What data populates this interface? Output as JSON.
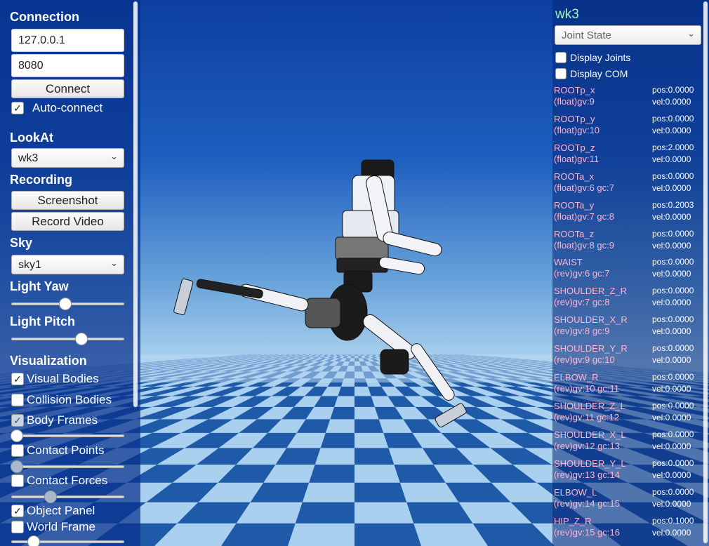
{
  "connection": {
    "title": "Connection",
    "ip": "127.0.0.1",
    "port": "8080",
    "connect_label": "Connect",
    "auto_connect_label": "Auto-connect",
    "auto_connect_checked": true
  },
  "lookat": {
    "title": "LookAt",
    "selected": "wk3"
  },
  "recording": {
    "title": "Recording",
    "screenshot_label": "Screenshot",
    "record_label": "Record Video"
  },
  "sky": {
    "title": "Sky",
    "selected": "sky1"
  },
  "light": {
    "yaw_title": "Light Yaw",
    "yaw_value": 0.48,
    "pitch_title": "Light Pitch",
    "pitch_value": 0.62
  },
  "visualization": {
    "title": "Visualization",
    "visual_bodies": {
      "label": "Visual Bodies",
      "checked": true
    },
    "collision_bodies": {
      "label": "Collision Bodies",
      "checked": false
    },
    "body_frames": {
      "label": "Body Frames",
      "checked": true,
      "slider": 0.05
    },
    "contact_points": {
      "label": "Contact Points",
      "checked": false,
      "slider": 0.05
    },
    "contact_forces": {
      "label": "Contact Forces",
      "checked": false,
      "slider": 0.35
    },
    "object_panel": {
      "label": "Object Panel",
      "checked": true
    },
    "world_frame": {
      "label": "World Frame",
      "checked": false,
      "slider": 0.2
    }
  },
  "object_panel": {
    "name": "wk3",
    "view_selected": "Joint State",
    "display_joints_label": "Display Joints",
    "display_com_label": "Display COM",
    "joints": [
      {
        "name": "ROOTp_x",
        "type": "(float)gv:9",
        "pos": "pos:0.0000",
        "vel": "vel:0.0000"
      },
      {
        "name": "ROOTp_y",
        "type": "(float)gv:10",
        "pos": "pos:0.0000",
        "vel": "vel:0.0000"
      },
      {
        "name": "ROOTp_z",
        "type": "(float)gv:11",
        "pos": "pos:2.0000",
        "vel": "vel:0.0000"
      },
      {
        "name": "ROOTa_x",
        "type": "(float)gv:6 gc:7",
        "pos": "pos:0.0000",
        "vel": "vel:0.0000"
      },
      {
        "name": "ROOTa_y",
        "type": "(float)gv:7 gc:8",
        "pos": "pos:0.2003",
        "vel": "vel:0.0000"
      },
      {
        "name": "ROOTa_z",
        "type": "(float)gv:8 gc:9",
        "pos": "pos:0.0000",
        "vel": "vel:0.0000"
      },
      {
        "name": "WAIST",
        "type": "(rev)gv:6 gc:7",
        "pos": "pos:0.0000",
        "vel": "vel:0.0000"
      },
      {
        "name": "SHOULDER_Z_R",
        "type": "(rev)gv:7 gc:8",
        "pos": "pos:0.0000",
        "vel": "vel:0.0000"
      },
      {
        "name": "SHOULDER_X_R",
        "type": "(rev)gv:8 gc:9",
        "pos": "pos:0.0000",
        "vel": "vel:0.0000"
      },
      {
        "name": "SHOULDER_Y_R",
        "type": "(rev)gv:9 gc:10",
        "pos": "pos:0.0000",
        "vel": "vel:0.0000"
      },
      {
        "name": "ELBOW_R",
        "type": "(rev)gv:10 gc:11",
        "pos": "pos:0.0000",
        "vel": "vel:0.0000"
      },
      {
        "name": "SHOULDER_Z_L",
        "type": "(rev)gv:11 gc:12",
        "pos": "pos:0.0000",
        "vel": "vel:0.0000"
      },
      {
        "name": "SHOULDER_X_L",
        "type": "(rev)gv:12 gc:13",
        "pos": "pos:0.0000",
        "vel": "vel:0.0000"
      },
      {
        "name": "SHOULDER_Y_L",
        "type": "(rev)gv:13 gc:14",
        "pos": "pos:0.0000",
        "vel": "vel:0.0000"
      },
      {
        "name": "ELBOW_L",
        "type": "(rev)gv:14 gc:15",
        "pos": "pos:0.0000",
        "vel": "vel:0.0000"
      },
      {
        "name": "HIP_Z_R",
        "type": "(rev)gv:15 gc:16",
        "pos": "pos:0.1000",
        "vel": "vel:0.0000"
      }
    ]
  },
  "colors": {
    "sky": "#1e5fbf",
    "tile_dark": "#1f5aa8",
    "tile_light": "#a9d0ef",
    "joint_name": "#ffb4cf",
    "object_name": "#9ff5b9"
  },
  "icons": {
    "dropdown": "chevron-down-icon",
    "check": "check-icon"
  }
}
